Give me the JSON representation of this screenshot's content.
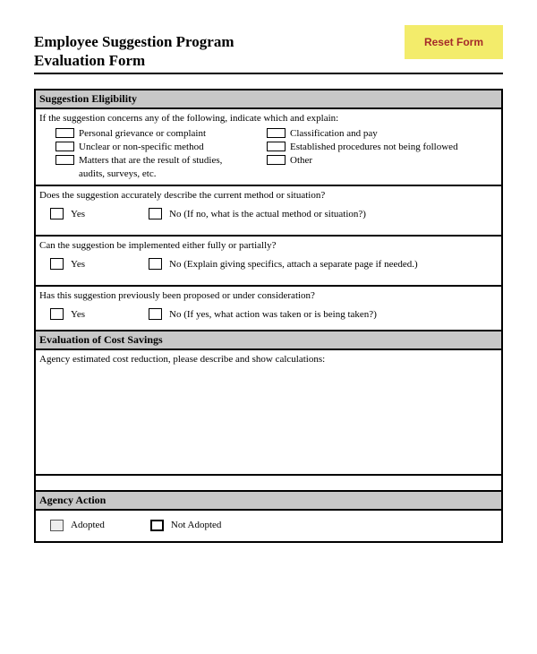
{
  "header": {
    "title_line1": "Employee Suggestion Program",
    "title_line2": "Evaluation Form",
    "reset_button_label": "Reset Form"
  },
  "sections": {
    "eligibility": {
      "heading": "Suggestion Eligibility",
      "intro": "If the suggestion concerns any of the following, indicate which and explain:",
      "options_left": [
        "Personal grievance or complaint",
        "Unclear or non-specific method",
        "Matters that are the result of studies, audits, surveys, etc."
      ],
      "options_right": [
        "Classification and pay",
        "Established procedures not being followed",
        "Other"
      ],
      "q1": "Does the suggestion accurately describe the current method or situation?",
      "q1_yes": "Yes",
      "q1_no": "No  (If no, what is the actual method or situation?)",
      "q2": "Can the suggestion be implemented either fully or partially?",
      "q2_yes": "Yes",
      "q2_no": "No  (Explain giving specifics, attach a separate page if needed.)",
      "q3": "Has this suggestion previously been proposed or under consideration?",
      "q3_yes": "Yes",
      "q3_no": "No  (If yes, what action was taken or is being taken?)"
    },
    "cost_savings": {
      "heading": "Evaluation of Cost Savings",
      "prompt": "Agency estimated cost reduction, please describe and show calculations:"
    },
    "agency_action": {
      "heading": "Agency Action",
      "adopted": "Adopted",
      "not_adopted": "Not Adopted"
    }
  }
}
